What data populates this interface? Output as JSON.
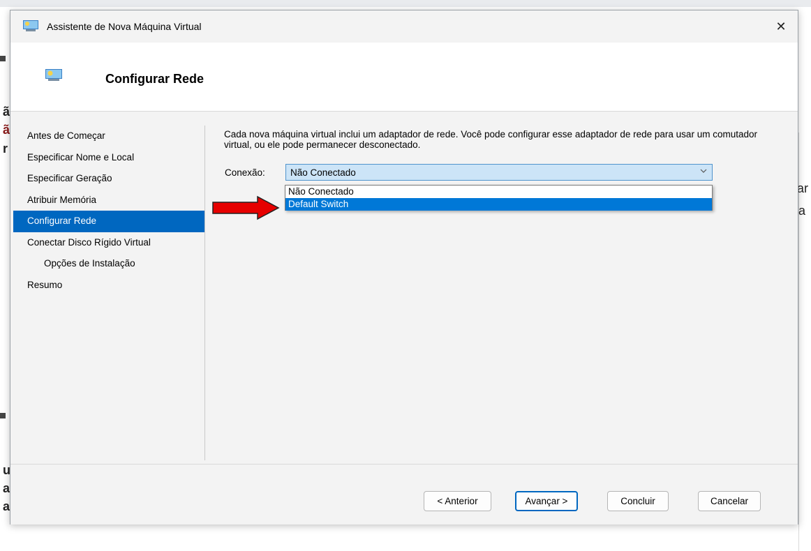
{
  "window": {
    "title": "Assistente de Nova Máquina Virtual",
    "close_glyph": "✕",
    "icon": "hyperv-icon"
  },
  "header": {
    "title": "Configurar Rede",
    "icon": "hyperv-icon"
  },
  "nav": {
    "items": [
      {
        "label": "Antes de Começar",
        "active": false,
        "indent": false
      },
      {
        "label": "Especificar Nome e Local",
        "active": false,
        "indent": false
      },
      {
        "label": "Especificar Geração",
        "active": false,
        "indent": false
      },
      {
        "label": "Atribuir Memória",
        "active": false,
        "indent": false
      },
      {
        "label": "Configurar Rede",
        "active": true,
        "indent": false
      },
      {
        "label": "Conectar Disco Rígido Virtual",
        "active": false,
        "indent": false
      },
      {
        "label": "Opções de Instalação",
        "active": false,
        "indent": true
      },
      {
        "label": "Resumo",
        "active": false,
        "indent": false
      }
    ]
  },
  "main": {
    "description": "Cada nova máquina virtual inclui um adaptador de rede. Você pode configurar esse adaptador de rede para usar um comutador virtual, ou ele pode permanecer desconectado.",
    "connection_label": "Conexão:",
    "connection_value": "Não Conectado",
    "dropdown_options": [
      "Não Conectado",
      "Default Switch"
    ],
    "highlighted_option": "Default Switch"
  },
  "footer": {
    "back_label": "< Anterior",
    "next_label": "Avançar >",
    "finish_label": "Concluir",
    "cancel_label": "Cancelar"
  },
  "background": {
    "left_fragments": [
      "ã",
      "ã",
      "r",
      "u",
      "a",
      "a"
    ],
    "right_fragments": [
      "ar",
      "a"
    ]
  },
  "colors": {
    "accent": "#0067c0",
    "highlight": "#0078d7",
    "combo_bg": "#cce4f7",
    "annotation_arrow": "#e60000"
  }
}
